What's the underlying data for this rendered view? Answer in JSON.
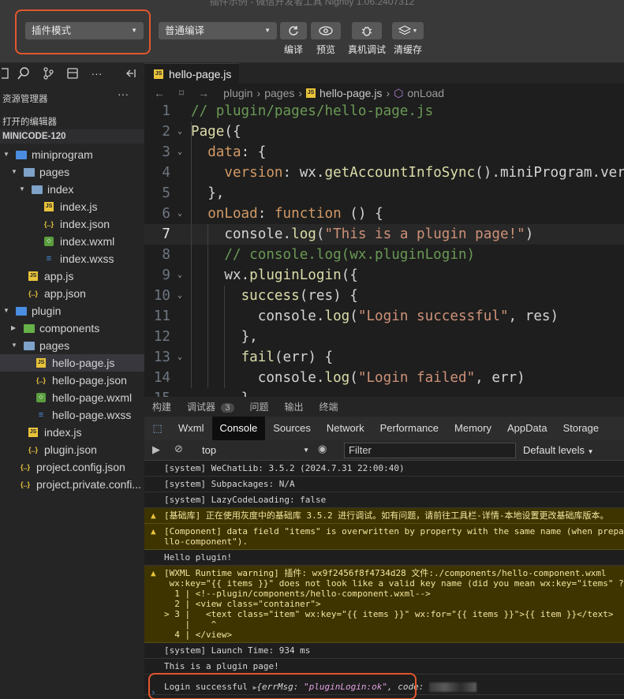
{
  "window": {
    "title": "插件示例 - 微信开发者工具 Nightly 1.06.2407312"
  },
  "toolbar": {
    "mode_select": "插件模式",
    "compile_select": "普通编译",
    "compile_label": "编译",
    "preview_label": "预览",
    "device_debug_label": "真机调试",
    "clear_cache_label": "清缓存"
  },
  "explorer": {
    "title": "资源管理器",
    "open_editors": "打开的编辑器",
    "project": "MINICODE-120",
    "tree": [
      {
        "label": "miniprogram",
        "type": "folder-plugin"
      },
      {
        "label": "pages",
        "type": "folder"
      },
      {
        "label": "index",
        "type": "folder"
      },
      {
        "label": "index.js",
        "type": "js"
      },
      {
        "label": "index.json",
        "type": "json"
      },
      {
        "label": "index.wxml",
        "type": "wxml"
      },
      {
        "label": "index.wxss",
        "type": "wxss"
      },
      {
        "label": "app.js",
        "type": "js"
      },
      {
        "label": "app.json",
        "type": "json"
      },
      {
        "label": "plugin",
        "type": "folder-plugin"
      },
      {
        "label": "components",
        "type": "folder-green"
      },
      {
        "label": "pages",
        "type": "folder"
      },
      {
        "label": "hello-page.js",
        "type": "js"
      },
      {
        "label": "hello-page.json",
        "type": "json"
      },
      {
        "label": "hello-page.wxml",
        "type": "wxml"
      },
      {
        "label": "hello-page.wxss",
        "type": "wxss"
      },
      {
        "label": "index.js",
        "type": "js"
      },
      {
        "label": "plugin.json",
        "type": "json"
      },
      {
        "label": "project.config.json",
        "type": "json"
      },
      {
        "label": "project.private.confi...",
        "type": "json"
      }
    ]
  },
  "editor": {
    "tab": "hello-page.js",
    "breadcrumb": [
      "plugin",
      "pages",
      "hello-page.js",
      "onLoad"
    ],
    "lines": [
      {
        "n": "1",
        "text": "// plugin/pages/hello-page.js"
      },
      {
        "n": "2",
        "text": "Page({"
      },
      {
        "n": "3",
        "text": "  data: {"
      },
      {
        "n": "4",
        "text": "    version: wx.getAccountInfoSync().miniProgram.ver"
      },
      {
        "n": "5",
        "text": "  },"
      },
      {
        "n": "6",
        "text": "  onLoad: function () {"
      },
      {
        "n": "7",
        "text": "    console.log(\"This is a plugin page!\")"
      },
      {
        "n": "8",
        "text": "    // console.log(wx.pluginLogin)"
      },
      {
        "n": "9",
        "text": "    wx.pluginLogin({"
      },
      {
        "n": "10",
        "text": "      success(res) {"
      },
      {
        "n": "11",
        "text": "        console.log(\"Login successful\", res)"
      },
      {
        "n": "12",
        "text": "      },"
      },
      {
        "n": "13",
        "text": "      fail(err) {"
      },
      {
        "n": "14",
        "text": "        console.log(\"Login failed\", err)"
      },
      {
        "n": "15",
        "text": "      }"
      }
    ]
  },
  "panel": {
    "tabs": [
      "构建",
      "调试器",
      "问题",
      "输出",
      "终端"
    ],
    "debugger_badge": "3",
    "devtools_tabs": [
      "Wxml",
      "Console",
      "Sources",
      "Network",
      "Performance",
      "Memory",
      "AppData",
      "Storage"
    ],
    "context": "top",
    "filter_placeholder": "Filter",
    "levels": "Default levels",
    "logs": [
      {
        "kind": "log",
        "text": "[system] WeChatLib: 3.5.2 (2024.7.31 22:00:40)"
      },
      {
        "kind": "log",
        "text": "[system] Subpackages: N/A"
      },
      {
        "kind": "log",
        "text": "[system] LazyCodeLoading: false"
      },
      {
        "kind": "warn",
        "text": "[基础库] 正在使用灰度中的基础库 3.5.2 进行调试。如有问题，请前往工具栏-详情-本地设置更改基础库版本。"
      },
      {
        "kind": "warn",
        "text": "[Component] data field \"items\" is overwritten by property with the same name (when prepa\nllo-component\")."
      },
      {
        "kind": "log",
        "text": "Hello plugin!"
      },
      {
        "kind": "warn",
        "text": "[WXML Runtime warning] 插件: wx9f2456f8f4734d28 文件:./components/hello-component.wxml\n wx:key=\"{{ items }}\" does not look like a valid key name (did you mean wx:key=\"items\" ?\n  1 | <!--plugin/components/hello-component.wxml-->\n  2 | <view class=\"container\">\n> 3 |   <text class=\"item\" wx:key=\"{{ items }}\" wx:for=\"{{ items }}\">{{ item }}</text>\n    |    ^\n  4 | </view>"
      },
      {
        "kind": "log",
        "text": "[system] Launch Time: 934 ms"
      },
      {
        "kind": "log",
        "text": "This is a plugin page!"
      }
    ],
    "last_log_prefix": "Login successful",
    "last_log_obj": "{errMsg: \"pluginLogin:ok\", code: "
  }
}
